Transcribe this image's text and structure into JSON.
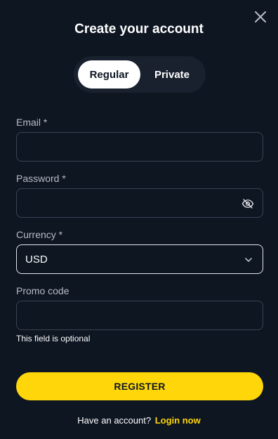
{
  "modal": {
    "title": "Create your account",
    "close_icon": "close-icon"
  },
  "account_type": {
    "tabs": [
      {
        "label": "Regular",
        "active": true
      },
      {
        "label": "Private",
        "active": false
      }
    ]
  },
  "form": {
    "email": {
      "label": "Email *",
      "value": "",
      "placeholder": ""
    },
    "password": {
      "label": "Password *",
      "value": "",
      "placeholder": "",
      "toggle_icon": "eye-off-icon"
    },
    "currency": {
      "label": "Currency *",
      "value": "USD",
      "icon": "chevron-down-icon"
    },
    "promo": {
      "label": "Promo code",
      "value": "",
      "placeholder": "",
      "hint": "This field is optional"
    }
  },
  "register_button": {
    "label": "REGISTER"
  },
  "footer": {
    "text": "Have an account?",
    "link": "Login now"
  },
  "colors": {
    "background": "#0e1622",
    "accent": "#ffd60a",
    "field_border": "#3a4252",
    "segment_bg": "#19212e",
    "label": "#b7bcc7"
  }
}
